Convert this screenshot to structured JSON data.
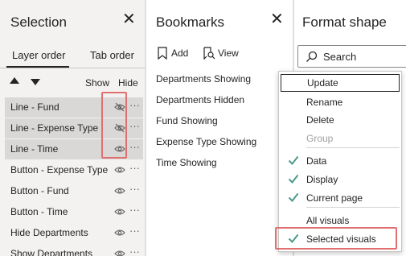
{
  "selection": {
    "title": "Selection",
    "tabs": [
      "Layer order",
      "Tab order"
    ],
    "columns": {
      "show": "Show",
      "hide": "Hide"
    },
    "layers": [
      {
        "label": "Line - Fund",
        "selected": true,
        "hidden": true
      },
      {
        "label": "Line - Expense Type",
        "selected": true,
        "hidden": true
      },
      {
        "label": "Line - Time",
        "selected": true,
        "hidden": false
      },
      {
        "label": "Button -  Expense Type",
        "selected": false,
        "hidden": false
      },
      {
        "label": "Button - Fund",
        "selected": false,
        "hidden": false
      },
      {
        "label": "Button - Time",
        "selected": false,
        "hidden": false
      },
      {
        "label": "Hide Departments",
        "selected": false,
        "hidden": false
      },
      {
        "label": "Show Departments",
        "selected": false,
        "hidden": false
      }
    ]
  },
  "bookmarks": {
    "title": "Bookmarks",
    "add_label": "Add",
    "view_label": "View",
    "items": [
      "Departments Showing",
      "Departments Hidden",
      "Fund Showing",
      "Expense Type Showing",
      "Time Showing"
    ]
  },
  "format": {
    "title": "Format shape",
    "search_placeholder": "Search"
  },
  "context_menu": {
    "items": [
      {
        "label": "Update",
        "checked": false,
        "disabled": false,
        "focused": true
      },
      {
        "label": "Rename",
        "checked": false,
        "disabled": false,
        "focused": false
      },
      {
        "label": "Delete",
        "checked": false,
        "disabled": false,
        "focused": false
      },
      {
        "label": "Group",
        "checked": false,
        "disabled": true,
        "focused": false
      },
      {
        "label": "Data",
        "checked": true,
        "disabled": false,
        "focused": false
      },
      {
        "label": "Display",
        "checked": true,
        "disabled": false,
        "focused": false
      },
      {
        "label": "Current page",
        "checked": true,
        "disabled": false,
        "focused": false
      },
      {
        "label": "All visuals",
        "checked": false,
        "disabled": false,
        "focused": false
      },
      {
        "label": "Selected visuals",
        "checked": true,
        "disabled": false,
        "focused": false
      }
    ]
  },
  "colors": {
    "highlight_box": "#e07070",
    "check": "#4a9a8a",
    "selected_row": "#d9d8d6"
  }
}
